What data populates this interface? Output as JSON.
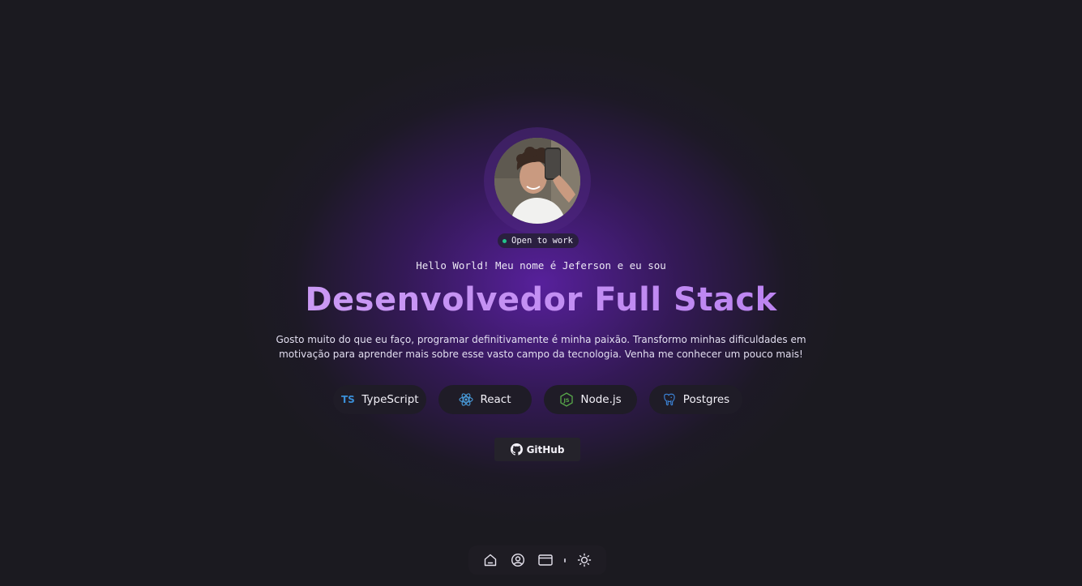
{
  "profile": {
    "status_label": "Open to work",
    "greeting": "Hello World! Meu nome é Jeferson e eu sou",
    "headline": "Desenvolvedor Full Stack",
    "bio_line1": "Gosto muito do que eu faço, programar definitivamente é minha paixão. Transformo minhas dificuldades em",
    "bio_line2": "motivação para aprender mais sobre esse vasto campo da tecnologia. Venha me conhecer um pouco mais!"
  },
  "technologies": [
    {
      "label": "TypeScript",
      "icon": "typescript-icon",
      "icon_text": "TS",
      "color": "#3a8fd8"
    },
    {
      "label": "React",
      "icon": "react-icon",
      "color": "#4a9fe0"
    },
    {
      "label": "Node.js",
      "icon": "nodejs-icon",
      "color": "#58a84a"
    },
    {
      "label": "Postgres",
      "icon": "postgres-icon",
      "color": "#3b7fd0"
    }
  ],
  "links": {
    "github_label": "GitHub"
  },
  "dock": {
    "items": [
      {
        "icon": "home-icon"
      },
      {
        "icon": "user-circle-icon"
      },
      {
        "icon": "window-icon"
      },
      {
        "icon": "sun-icon"
      }
    ]
  },
  "colors": {
    "background": "#1b1a20",
    "glow": "#6822be",
    "accent": "#c99cf5",
    "status_dot": "#22c38a"
  }
}
